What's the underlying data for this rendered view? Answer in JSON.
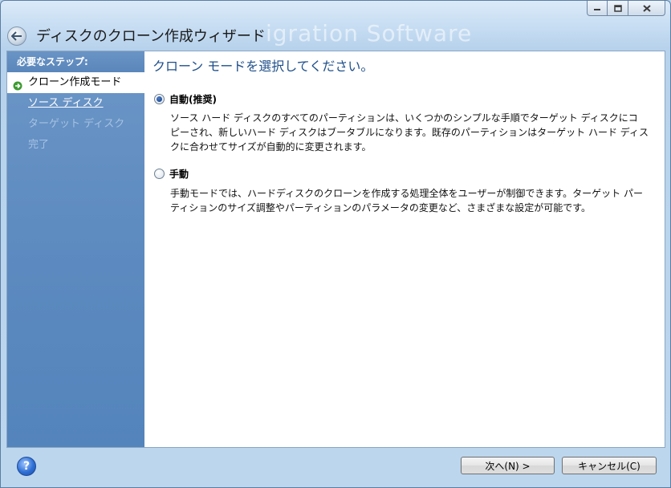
{
  "window": {
    "title": "ディスクのクローン作成ウィザード",
    "watermark": "igration Software"
  },
  "sidebar": {
    "heading": "必要なステップ:",
    "steps": [
      {
        "label": "クローン作成モード",
        "state": "active"
      },
      {
        "label": "ソース ディスク",
        "state": "link"
      },
      {
        "label": "ターゲット ディスク",
        "state": "disabled"
      },
      {
        "label": "完了",
        "state": "disabled"
      }
    ]
  },
  "main": {
    "title": "クローン モードを選択してください。",
    "options": [
      {
        "label": "自動(推奨)",
        "selected": true,
        "description": [
          "ソース ハード ディスクのすべてのパーティションは、いくつかのシンプルな手順でターゲット ディスクにコ",
          "ピーされ、新しいハード ディスクはブータブルになります。既存のパーティションはターゲット ハード ディス",
          "クに合わせてサイズが自動的に変更されます。"
        ]
      },
      {
        "label": "手動",
        "selected": false,
        "description": [
          "手動モードでは、ハードディスクのクローンを作成する処理全体をユーザーが制御できます。ターゲット パー",
          "ティションのサイズ調整やパーティションのパラメータの変更など、さまざまな設定が可能です。"
        ]
      }
    ]
  },
  "footer": {
    "help_label": "?",
    "next_label": "次へ(N) >",
    "cancel_label": "キャンセル(C)"
  },
  "colors": {
    "sidebar": "#5f8cc1",
    "title": "#1e4f8a"
  }
}
